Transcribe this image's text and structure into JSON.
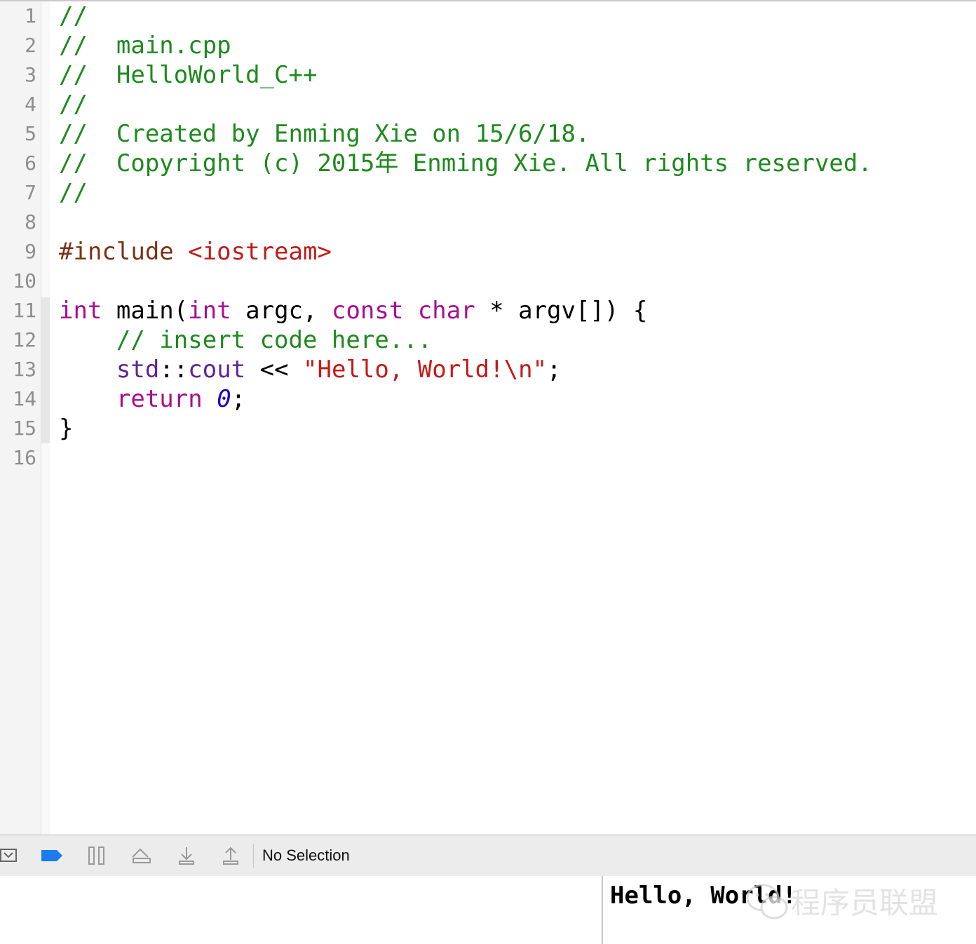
{
  "line_numbers": [
    "1",
    "2",
    "3",
    "4",
    "5",
    "6",
    "7",
    "8",
    "9",
    "10",
    "11",
    "12",
    "13",
    "14",
    "15",
    "16"
  ],
  "code": {
    "l1": {
      "comment": "//"
    },
    "l2": {
      "comment": "//  main.cpp"
    },
    "l3": {
      "comment": "//  HelloWorld_C++"
    },
    "l4": {
      "comment": "//"
    },
    "l5": {
      "comment": "//  Created by Enming Xie on 15/6/18."
    },
    "l6": {
      "comment": "//  Copyright (c) 2015年 Enming Xie. All rights reserved."
    },
    "l7": {
      "comment": "//"
    },
    "l9": {
      "directive": "#include ",
      "header": "<iostream>"
    },
    "l11": {
      "kw_int1": "int",
      "main": " main(",
      "kw_int2": "int",
      "argc": " argc, ",
      "kw_const": "const",
      "sp1": " ",
      "kw_char": "char",
      "rest": " * argv[]) {"
    },
    "l12": {
      "indent": "    ",
      "comment": "// insert code here..."
    },
    "l13": {
      "indent": "    ",
      "std": "std",
      "colons": "::",
      "cout": "cout",
      "op": " << ",
      "string": "\"Hello, World!\\n\"",
      "semi": ";"
    },
    "l14": {
      "indent": "    ",
      "kw_return": "return",
      "sp": " ",
      "zero": "0",
      "semi": ";"
    },
    "l15": {
      "brace": "}"
    }
  },
  "debug_bar": {
    "jump_bar_text": "No Selection",
    "icons": [
      "hide-debug-area-icon",
      "breakpoints-toggle-icon",
      "pause-icon",
      "step-over-icon",
      "step-into-icon",
      "step-out-icon"
    ]
  },
  "console": {
    "output": "Hello, World!"
  },
  "watermark": {
    "text": "程序员联盟"
  },
  "colors": {
    "comment": "#1d8a1d",
    "keyword": "#aa0d91",
    "type": "#5c2699",
    "string": "#c41a16",
    "number": "#1c00cf",
    "preprocessor": "#7a3214",
    "breakpoint_blue": "#1a7cf0"
  }
}
